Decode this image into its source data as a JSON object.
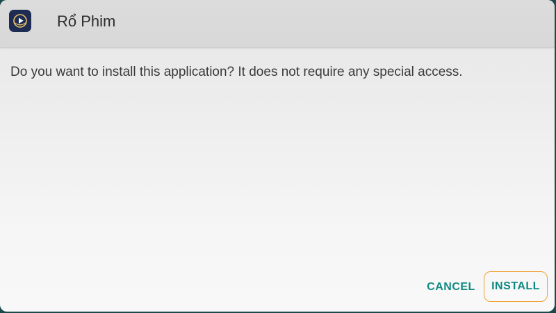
{
  "app": {
    "title": "Rổ Phim",
    "icon": "play-triangle-app-icon"
  },
  "dialog": {
    "message": "Do you want to install this application? It does not require any special access.",
    "cancel_label": "CANCEL",
    "install_label": "INSTALL"
  },
  "colors": {
    "accent": "#0f8a82",
    "focus_border": "#f0a030",
    "icon_background": "#1e2b52"
  }
}
